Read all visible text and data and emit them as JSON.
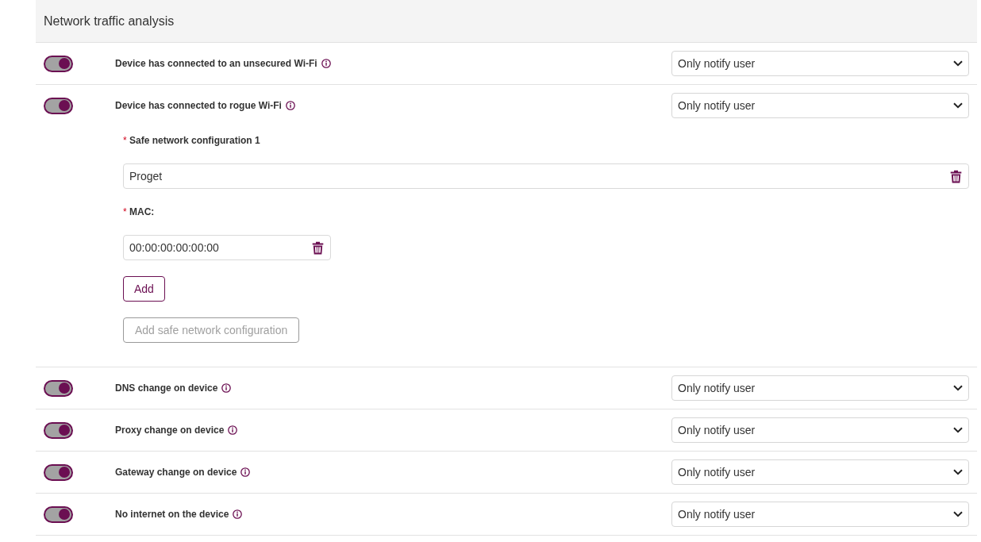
{
  "section": {
    "title": "Network traffic analysis"
  },
  "rules": [
    {
      "label": "Device has connected to an unsecured Wi-Fi",
      "on": true,
      "action": "Only notify user"
    },
    {
      "label": "Device has connected to rogue Wi-Fi",
      "on": true,
      "action": "Only notify user",
      "config": {
        "networks": [
          {
            "label": "Safe network configuration 1",
            "required_mark": "*",
            "name": "Proget",
            "mac_label": "MAC:",
            "mac_required_mark": "*",
            "macs": [
              "00:00:00:00:00:00"
            ],
            "add_label": "Add"
          }
        ],
        "add_network": {
          "label": "Add safe network configuration",
          "disabled": true
        }
      }
    },
    {
      "label": "DNS change on device",
      "on": true,
      "action": "Only notify user"
    },
    {
      "label": "Proxy change on device",
      "on": true,
      "action": "Only notify user"
    },
    {
      "label": "Gateway change on device",
      "on": true,
      "action": "Only notify user"
    },
    {
      "label": "No internet on the device",
      "on": true,
      "action": "Only notify user"
    }
  ]
}
